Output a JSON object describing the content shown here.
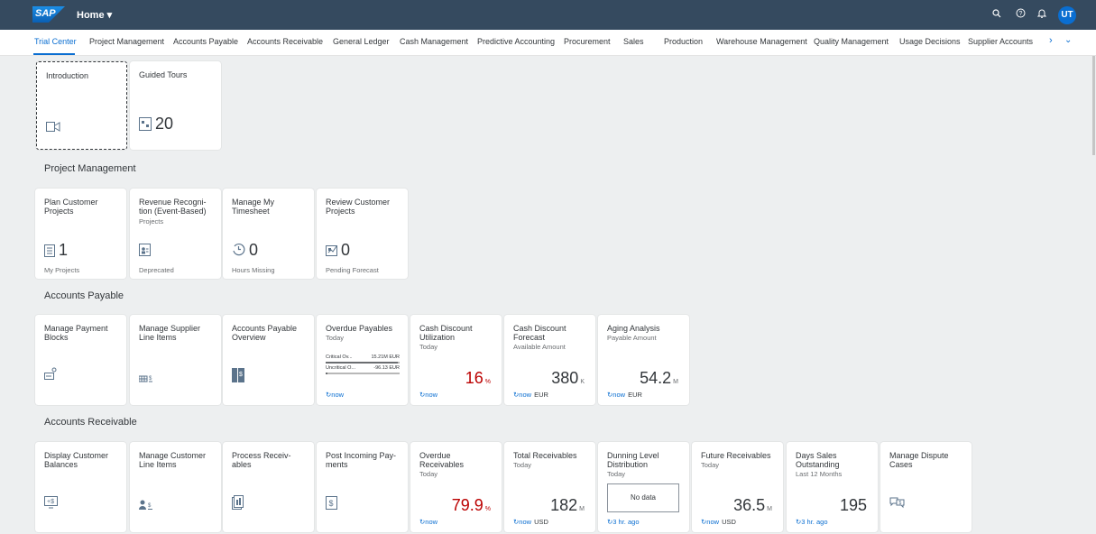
{
  "shell": {
    "logo": "SAP",
    "title": "Home ▾",
    "avatar_initials": "UT",
    "brand_color": "#354a5f",
    "accent_color": "#0a6ed1"
  },
  "tabs": [
    {
      "label": "Trial Center",
      "selected": true
    },
    {
      "label": "Project Management"
    },
    {
      "label": "Accounts Payable"
    },
    {
      "label": "Accounts Receivable"
    },
    {
      "label": "General Ledger"
    },
    {
      "label": "Cash Management"
    },
    {
      "label": "Predictive Accounting"
    },
    {
      "label": "Procurement"
    },
    {
      "label": "Sales"
    },
    {
      "label": "Production"
    },
    {
      "label": "Warehouse Management"
    },
    {
      "label": "Quality Management"
    },
    {
      "label": "Usage Decisions"
    },
    {
      "label": "Supplier Accounts"
    }
  ],
  "trial": {
    "intro": {
      "title": "Introduction",
      "icon": "video-icon"
    },
    "tours": {
      "title": "Guided Tours",
      "value": "20",
      "icon": "tours-icon"
    }
  },
  "pm": {
    "title": "Project Management",
    "tiles": [
      {
        "title": "Plan Customer\nProjects",
        "value": "1",
        "footer": "My Projects",
        "icon": "project-icon"
      },
      {
        "title": "Revenue Recogni-\ntion (Event-Based)",
        "subtitle": "Projects",
        "footer": "Deprecated",
        "icon": "contact-card-icon"
      },
      {
        "title": "Manage My\nTimesheet",
        "value": "0",
        "footer": "Hours Missing",
        "icon": "clock-icon"
      },
      {
        "title": "Review Customer\nProjects",
        "value": "0",
        "footer": "Pending Forecast",
        "icon": "forecast-icon"
      }
    ]
  },
  "ap": {
    "title": "Accounts Payable",
    "tiles": [
      {
        "title": "Manage Payment\nBlocks"
      },
      {
        "title": "Manage Supplier\nLine Items"
      },
      {
        "title": "Accounts Payable\nOverview"
      },
      {
        "title": "Overdue Payables",
        "subtitle": "Today",
        "refresh": "now",
        "bars": [
          {
            "label": "Critical Ov...",
            "value": "15.21M EUR",
            "fill": 0.97
          },
          {
            "label": "Uncritical O...",
            "value": "-96.13 EUR",
            "fill": 0.03
          }
        ]
      },
      {
        "title": "Cash Discount\nUtilization",
        "subtitle": "Today",
        "value": "16",
        "unit": "%",
        "refresh": "now"
      },
      {
        "title": "Cash Discount\nForecast",
        "subtitle": "Available Amount",
        "value": "380",
        "unit": "K",
        "refresh": "now",
        "currency": "EUR"
      },
      {
        "title": "Aging Analysis",
        "subtitle": "Payable Amount",
        "value": "54.2",
        "unit": "M",
        "refresh": "now",
        "currency": "EUR"
      }
    ]
  },
  "ar": {
    "title": "Accounts Receivable",
    "tiles": [
      {
        "title": "Display Customer\nBalances"
      },
      {
        "title": "Manage Customer\nLine Items"
      },
      {
        "title": "Process Receiv-\nables"
      },
      {
        "title": "Post Incoming Pay-\nments"
      },
      {
        "title": "Overdue\nReceivables",
        "subtitle": "Today",
        "value": "79.9",
        "unit": "%",
        "refresh": "now"
      },
      {
        "title": "Total Receivables",
        "subtitle": "Today",
        "value": "182",
        "unit": "M",
        "refresh": "now",
        "currency": "USD"
      },
      {
        "title": "Dunning Level\nDistribution",
        "subtitle": "Today",
        "nodata": "No data",
        "refresh": "3 hr. ago"
      },
      {
        "title": "Future Receivables",
        "subtitle": "Today",
        "value": "36.5",
        "unit": "M",
        "refresh": "now",
        "currency": "USD"
      },
      {
        "title": "Days Sales\nOutstanding",
        "subtitle": "Last 12 Months",
        "value": "195",
        "refresh": "3 hr. ago"
      },
      {
        "title": "Manage Dispute\nCases"
      }
    ]
  }
}
